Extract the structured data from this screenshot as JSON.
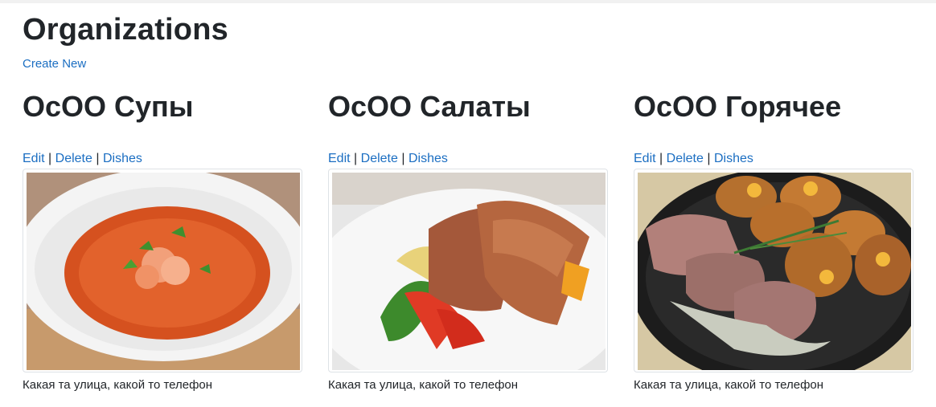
{
  "page": {
    "title": "Organizations",
    "create_new": "Create New"
  },
  "organizations": [
    {
      "name": "ОсОО Супы",
      "actions": {
        "edit": "Edit",
        "delete": "Delete",
        "dishes": "Dishes"
      },
      "image": "tomato-shrimp-soup-photo",
      "address": "Какая та улица, какой то телефон"
    },
    {
      "name": "ОсОО Салаты",
      "actions": {
        "edit": "Edit",
        "delete": "Delete",
        "dishes": "Dishes"
      },
      "image": "meat-salad-photo",
      "address": "Какая та улица, какой то телефон"
    },
    {
      "name": "ОсОО Горячее",
      "actions": {
        "edit": "Edit",
        "delete": "Delete",
        "dishes": "Dishes"
      },
      "image": "roast-pork-potatoes-photo",
      "address": "Какая та улица, какой то телефон"
    }
  ],
  "separator": "|",
  "colors": {
    "link": "#1b6ec2",
    "text": "#212529",
    "border": "#dee2e6"
  }
}
